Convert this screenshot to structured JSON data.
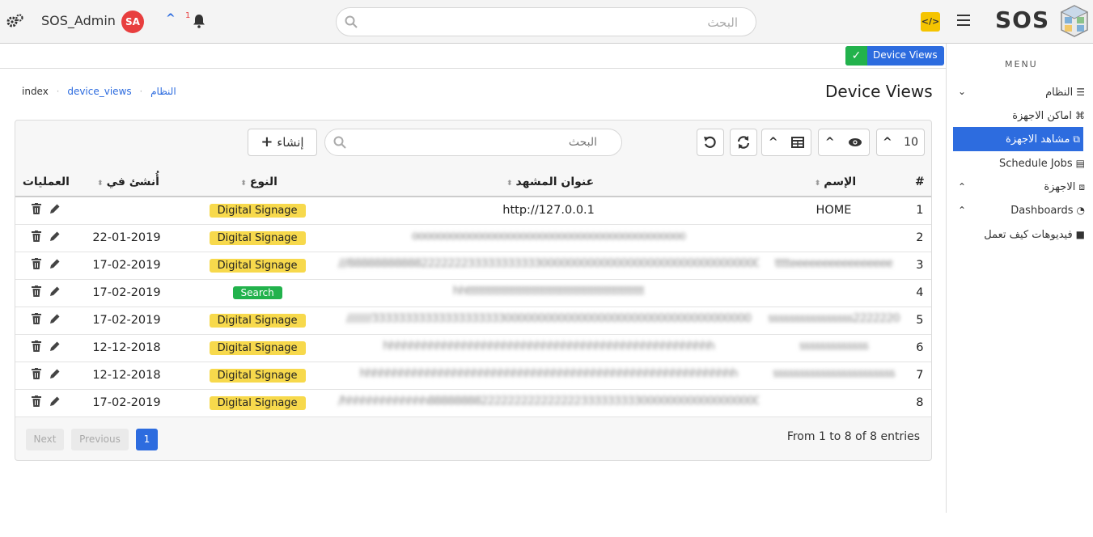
{
  "header": {
    "username": "SOS_Admin",
    "avatar_initials": "SA",
    "notification_count": "1",
    "search_placeholder": "البحث",
    "code_label": "</>",
    "brand": "SOS"
  },
  "status_badge": {
    "label": "Device Views"
  },
  "sidebar": {
    "menu_title": "MENU",
    "items": [
      {
        "label": "النظام",
        "icon": "sliders-icon",
        "icon_glyph": "☰",
        "arrow": "⌄"
      },
      {
        "label": "اماكن الاجهزة",
        "icon": "map-marker-icon",
        "icon_glyph": "⌘"
      },
      {
        "label": "مشاهد الاجهزة",
        "icon": "external-link-icon",
        "icon_glyph": "⧉",
        "active": true
      },
      {
        "label": "Schedule Jobs",
        "icon": "clipboard-icon",
        "icon_glyph": "▤"
      },
      {
        "label": "الاجهزة",
        "icon": "network-icon",
        "icon_glyph": "⧈",
        "arrow": "⌃"
      },
      {
        "label": "Dashboards",
        "icon": "speedometer-icon",
        "icon_glyph": "◔",
        "arrow": "⌃"
      },
      {
        "label": "فيديوهات كيف تعمل",
        "icon": "video-icon",
        "icon_glyph": "■"
      }
    ]
  },
  "page": {
    "title": "Device Views",
    "breadcrumb": [
      "index",
      "device_views",
      "النظام"
    ]
  },
  "toolbar": {
    "page_size": "10",
    "create_label": "إنشاء",
    "search_placeholder": "البحث"
  },
  "table": {
    "columns": {
      "num": "#",
      "name": "الإسم",
      "url": "عنوان المشهد",
      "type": "النوع",
      "created": "أُنشئ في",
      "ops": "العمليات"
    },
    "rows": [
      {
        "num": "1",
        "name": "HOME",
        "url": "http://127.0.0.1",
        "type": "Digital Signage",
        "type_style": "yellow",
        "created": "",
        "blurred": false
      },
      {
        "num": "2",
        "name": "",
        "url": "ooooooooooooooooooooooooooooooooooooooooooo",
        "type": "Digital Signage",
        "type_style": "yellow",
        "created": "22-01-2019",
        "blurred": true
      },
      {
        "num": "3",
        "name": "tttteeeeeeeeeeeeeeee",
        "url": "///88888888888222222233333333333000000000000000000000000000000000",
        "type": "Digital Signage",
        "type_style": "yellow",
        "created": "17-02-2019",
        "blurred": true
      },
      {
        "num": "4",
        "name": "",
        "url": "hhttttttttttttttttttttttttttttttttttttttttttttttt",
        "type": "Search",
        "type_style": "green",
        "created": "17-02-2019",
        "blurred": true
      },
      {
        "num": "5",
        "name": "ssssssssssssssss2222220",
        "url": "////////333333333333333333330000000000000000000000000000000000000",
        "type": "Digital Signage",
        "type_style": "yellow",
        "created": "17-02-2019",
        "blurred": true
      },
      {
        "num": "6",
        "name": "sssssssssssss",
        "url": "hhhhhhhhhhhhhhhhhhhhhhhhhhhhhhhhhhhhhhhhhhhhhhhhhh",
        "type": "Digital Signage",
        "type_style": "yellow",
        "created": "12-12-2018",
        "blurred": true
      },
      {
        "num": "7",
        "name": "sssssssssssssssssssssss",
        "url": "hhhhhhhhhhhhhhhhhhhhhhhhhhhhhhhhhhhhhhhhhhhhhhhhhhhhhhhhh",
        "type": "Digital Signage",
        "type_style": "yellow",
        "created": "12-12-2018",
        "blurred": true
      },
      {
        "num": "8",
        "name": "",
        "url": "/hhhhhhhhhhhhh88888888222222222222222333333333000000000000000000000",
        "type": "Digital Signage",
        "type_style": "yellow",
        "created": "17-02-2019",
        "blurred": true
      }
    ]
  },
  "pagination": {
    "info": "From 1 to 8 of 8 entries",
    "next_label": "Next",
    "previous_label": "Previous",
    "current_page": "1"
  },
  "colors": {
    "accent": "#2d6cdf",
    "success": "#22b24c",
    "warning": "#f7d94c",
    "danger": "#e83e3e"
  }
}
